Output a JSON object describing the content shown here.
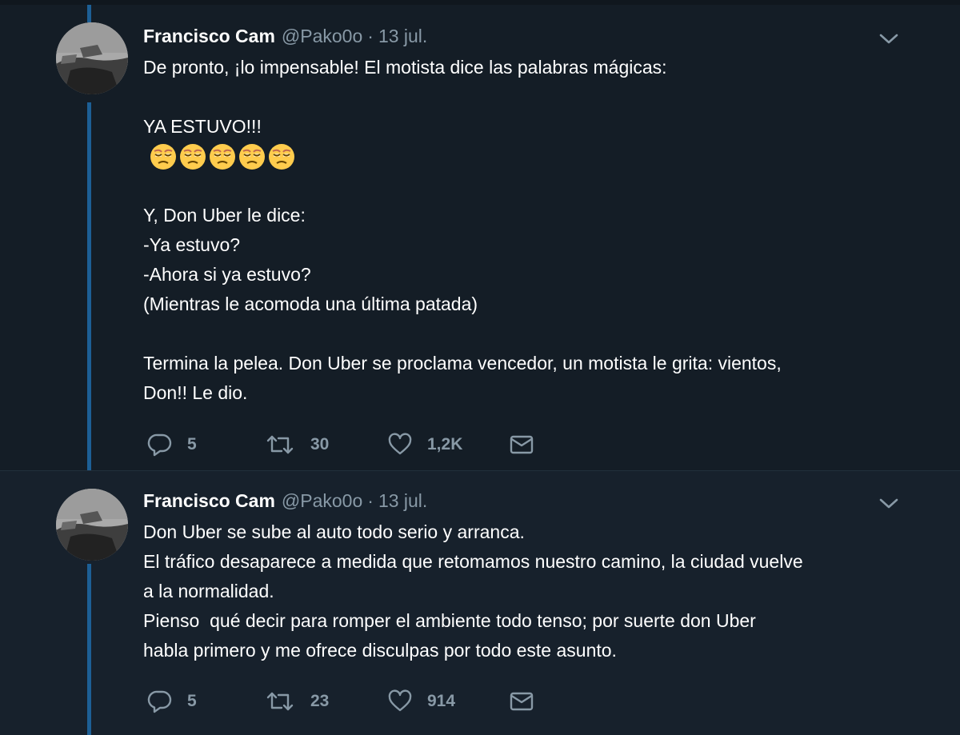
{
  "colors": {
    "background": "#141d26",
    "secondary_background": "#17212c",
    "text": "#ffffff",
    "muted": "#8899a6",
    "thread_line": "#1d5f95"
  },
  "tweets": [
    {
      "name": "Francisco Cam",
      "handle": "@Pako0o",
      "separator": "·",
      "date": "13 jul.",
      "lines": [
        "De pronto, ¡lo impensable! El motista dice las palabras mágicas:",
        "",
        "YA ESTUVO!!!",
        "😒😒😒😒😒",
        "",
        "Y, Don Uber le dice:",
        "-Ya estuvo?",
        "-Ahora si ya estuvo?",
        "(Mientras le acomoda una última patada)",
        "",
        "Termina la pelea. Don Uber se proclama vencedor, un motista le grita: vientos,",
        "Don!! Le dio."
      ],
      "stats": {
        "replies": "5",
        "retweets": "30",
        "likes": "1,2K"
      }
    },
    {
      "name": "Francisco Cam",
      "handle": "@Pako0o",
      "separator": "·",
      "date": "13 jul.",
      "lines": [
        "Don Uber se sube al auto todo serio y arranca.",
        "El tráfico desaparece a medida que retomamos nuestro camino, la ciudad vuelve",
        "a la normalidad.",
        "Pienso  qué decir para romper el ambiente todo tenso; por suerte don Uber",
        "habla primero y me ofrece disculpas por todo este asunto."
      ],
      "stats": {
        "replies": "5",
        "retweets": "23",
        "likes": "914"
      }
    }
  ],
  "icons": {
    "reply": "speech-bubble",
    "retweet": "retweet-arrows",
    "like": "heart-outline",
    "dm": "envelope",
    "more": "chevron-down",
    "emoji": "unamused-face"
  }
}
